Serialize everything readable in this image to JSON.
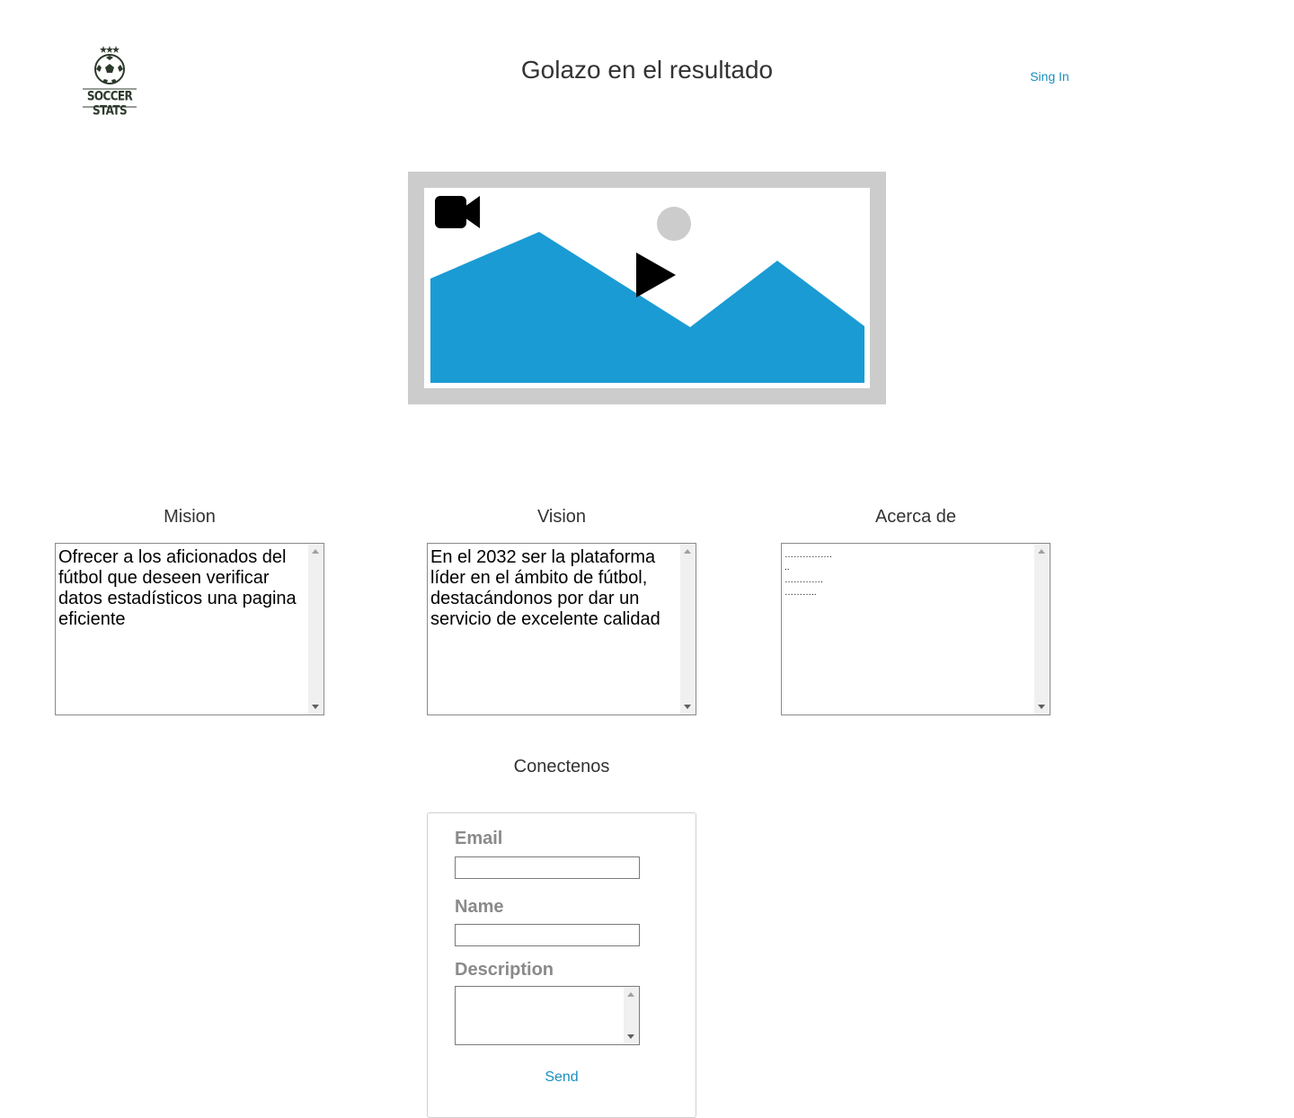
{
  "header": {
    "logo_text": "SOCCER STATS",
    "title": "Golazo en el resultado",
    "sign_in_label": "Sing In"
  },
  "video": {
    "icon": "video-camera-icon",
    "play_icon": "play-icon",
    "placeholder": "image-placeholder"
  },
  "sections": {
    "mision": {
      "heading": "Mision",
      "text": "Ofrecer a los aficionados del fútbol que deseen verificar datos estadísticos una pagina eficiente"
    },
    "vision": {
      "heading": "Vision",
      "text": "En el 2032 ser la plataforma líder en el ámbito de fútbol, destacándonos por dar un servicio de excelente calidad"
    },
    "acerca": {
      "heading": "Acerca de",
      "text": "…………….\n..\n………….\n……….."
    }
  },
  "contact": {
    "heading": "Conectenos",
    "email_label": "Email",
    "email_value": "",
    "name_label": "Name",
    "name_value": "",
    "description_label": "Description",
    "description_value": "",
    "send_label": "Send"
  },
  "colors": {
    "link": "#1a8fc0",
    "mountain": "#1a9bd4",
    "frame": "#cccccc",
    "label_gray": "#8a8a8a"
  }
}
